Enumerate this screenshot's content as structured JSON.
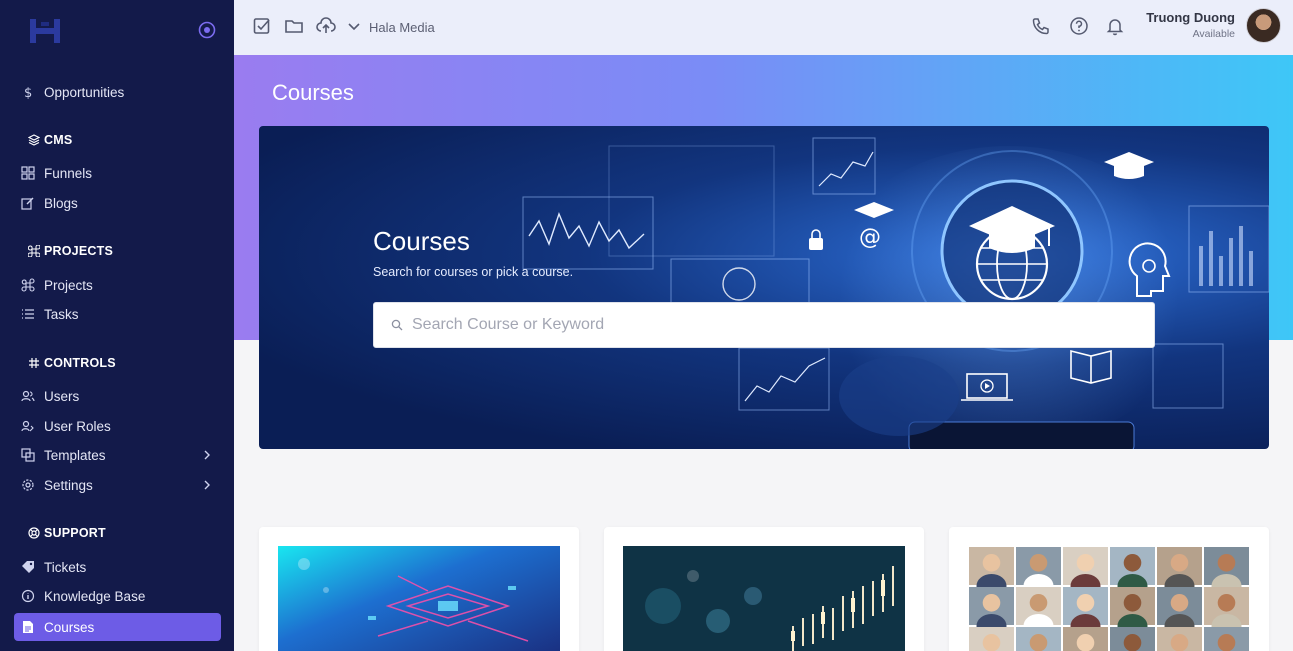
{
  "sidebar": {
    "items": {
      "opportunities": "Opportunities",
      "funnels": "Funnels",
      "blogs": "Blogs",
      "projects": "Projects",
      "tasks": "Tasks",
      "users": "Users",
      "user_roles": "User Roles",
      "templates": "Templates",
      "settings": "Settings",
      "tickets": "Tickets",
      "knowledge_base": "Knowledge Base",
      "courses": "Courses"
    },
    "sections": {
      "cms": "CMS",
      "projects": "PROJECTS",
      "controls": "CONTROLS",
      "support": "SUPPORT"
    },
    "active_color": "#6d5ce6"
  },
  "topbar": {
    "workspace": "Hala Media",
    "user_name": "Truong Duong",
    "user_status": "Available",
    "icons": [
      "checkbox-icon",
      "folder-icon",
      "upload-icon",
      "chevron-down-icon",
      "phone-icon",
      "help-icon",
      "bell-icon"
    ]
  },
  "page": {
    "title": "Courses"
  },
  "banner": {
    "title": "Courses",
    "subtitle": "Search for courses or pick a course.",
    "search_placeholder": "Search Course or Keyword"
  },
  "colors": {
    "sidebar_bg": "#131a4a",
    "header_gradient_start": "#9a7cf0",
    "header_gradient_end": "#3ec7f7"
  }
}
